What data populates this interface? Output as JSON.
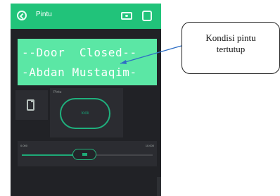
{
  "app": {
    "title": "Pintu"
  },
  "lcd": {
    "line1": "--Door  Closed--",
    "line2": "-Abdan Mustaqim-"
  },
  "lock_widget": {
    "label": "Pintu",
    "button_label": "lock"
  },
  "slider": {
    "min_label": "0.000",
    "max_label": "10.000",
    "value_fraction": 0.48
  },
  "annotation": {
    "line1": "Kondisi pintu",
    "line2": "tertutup"
  },
  "colors": {
    "header": "#21c37a",
    "lcd": "#5be7a5",
    "background": "#212226",
    "accent": "#1eaa77",
    "arrow": "#2f6fc5"
  },
  "icons": [
    "back-icon",
    "camera-icon",
    "menu-icon",
    "phone-icon"
  ]
}
